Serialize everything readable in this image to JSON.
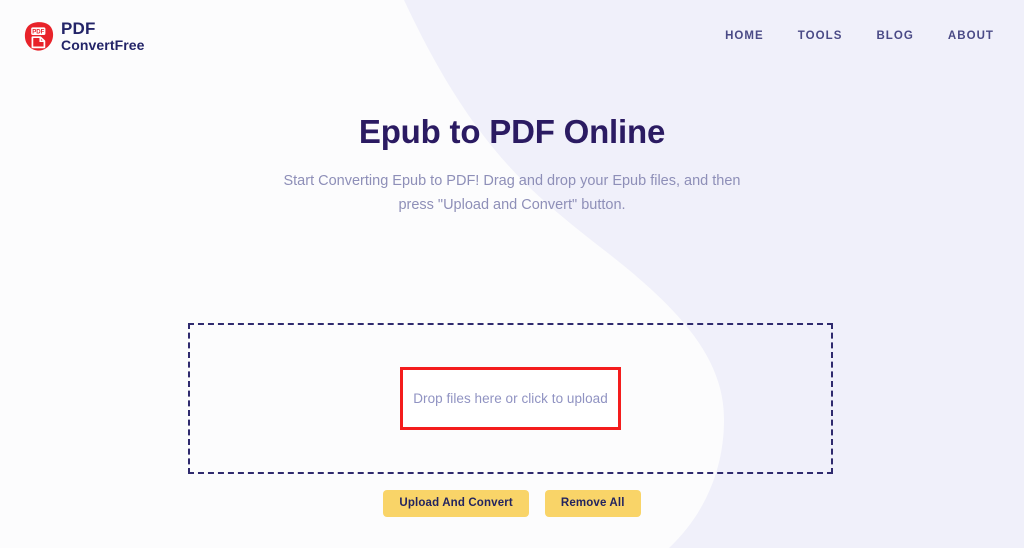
{
  "site": {
    "background_color": "#fcfcfd",
    "blob_color": "#f0f0fa",
    "accent_dark": "#2b1b62",
    "accent_yellow": "#f9d468",
    "highlight_red": "#f41d1d",
    "logo_red": "#e8232a"
  },
  "header": {
    "brand": {
      "icon": "pdf-document-icon",
      "line1": "PDF",
      "line2": "ConvertFree"
    },
    "nav": [
      {
        "label": "HOME"
      },
      {
        "label": "TOOLS"
      },
      {
        "label": "BLOG"
      },
      {
        "label": "ABOUT"
      }
    ]
  },
  "hero": {
    "title": "Epub to PDF Online",
    "subtitle": "Start Converting Epub to PDF! Drag and drop your Epub files, and then press \"Upload and Convert\" button."
  },
  "dropzone": {
    "label": "Drop files here or click to upload",
    "highlighted": true
  },
  "actions": {
    "upload_label": "Upload And Convert",
    "remove_label": "Remove All"
  }
}
